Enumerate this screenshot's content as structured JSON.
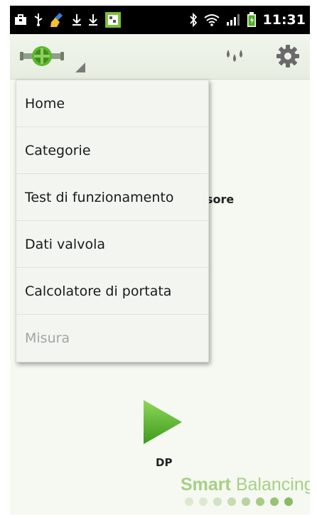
{
  "status_bar": {
    "time": "11:31",
    "icons": [
      "briefcase-icon",
      "usb-icon",
      "cleaner-broom-icon",
      "download-icon",
      "download-icon",
      "app-notification-icon",
      "bluetooth-icon",
      "wifi-icon",
      "signal-icon",
      "battery-charging-icon"
    ]
  },
  "action_bar": {
    "logo_icon": "valve-logo-icon",
    "actions": [
      "water-drops-icon",
      "gear-icon"
    ]
  },
  "menu": {
    "items": [
      {
        "label": "Home",
        "enabled": true
      },
      {
        "label": "Categorie",
        "enabled": true
      },
      {
        "label": "Test di funzionamento",
        "enabled": true
      },
      {
        "label": "Dati valvola",
        "enabled": true
      },
      {
        "label": "Calcolatore di portata",
        "enabled": true
      },
      {
        "label": "Misura",
        "enabled": false
      }
    ]
  },
  "background": {
    "partial_text": "sore",
    "play_label": "DP",
    "brand_bold": "Smart",
    "brand_light": "Balancing"
  },
  "colors": {
    "accent_green": "#5cb82e",
    "brand_green": "#a8cf86"
  }
}
